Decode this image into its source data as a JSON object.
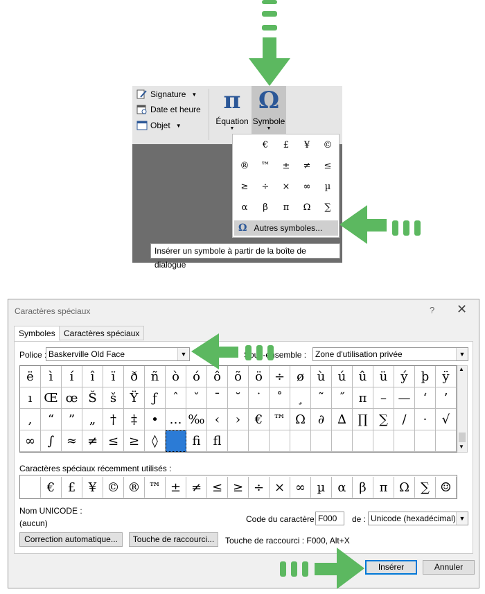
{
  "ribbon": {
    "signature": "Signature",
    "date_heure": "Date et heure",
    "objet": "Objet",
    "equation": "Équation",
    "symbole": "Symbole",
    "equation_glyph": "π",
    "symbole_glyph": "Ω"
  },
  "dropdown": {
    "symbols": [
      "",
      "€",
      "£",
      "¥",
      "©",
      "®",
      "™",
      "±",
      "≠",
      "≤",
      "≥",
      "÷",
      "×",
      "∞",
      "µ",
      "α",
      "β",
      "π",
      "Ω",
      "∑"
    ],
    "more_label": "Autres symboles...",
    "more_icon": "Ω"
  },
  "tooltip": "Insérer un symbole à partir de la boîte de dialogue",
  "stray_symbol": "",
  "dialog": {
    "title": "Caractères spéciaux",
    "help": "?",
    "close": "✕",
    "tabs": [
      "Symboles",
      "Caractères spéciaux"
    ],
    "police_label": "Police :",
    "police_value": "Baskerville Old Face",
    "sous_ensemble_label": "Sous-ensemble :",
    "sous_ensemble_value": "Zone d'utilisation privée",
    "grid": [
      [
        "ë",
        "ì",
        "í",
        "î",
        "ï",
        "ð",
        "ñ",
        "ò",
        "ó",
        "ô",
        "õ",
        "ö",
        "÷",
        "ø",
        "ù",
        "ú",
        "û",
        "ü",
        "ý",
        "þ",
        "ÿ"
      ],
      [
        "ı",
        "Œ",
        "œ",
        "Š",
        "š",
        "Ÿ",
        "ƒ",
        "ˆ",
        "ˇ",
        "¯",
        "˘",
        "˙",
        "˚",
        "¸",
        "˜",
        "˝",
        "π",
        "–",
        "—",
        "‘",
        "’"
      ],
      [
        ",",
        "“",
        "”",
        "„",
        "†",
        "‡",
        "•",
        "…",
        "‰",
        "‹",
        "›",
        "€",
        "™",
        "Ω",
        "∂",
        "∆",
        "∏",
        "∑",
        "∕",
        "·",
        "√"
      ],
      [
        "∞",
        "∫",
        "≈",
        "≠",
        "≤",
        "≥",
        "◊",
        "",
        "ﬁ",
        "ﬂ",
        "",
        "",
        "",
        "",
        "",
        "",
        "",
        "",
        "",
        "",
        ""
      ]
    ],
    "selected": {
      "row": 3,
      "col": 7
    },
    "recent_label": "Caractères spéciaux récemment utilisés :",
    "recent": [
      "",
      "€",
      "£",
      "¥",
      "©",
      "®",
      "™",
      "±",
      "≠",
      "≤",
      "≥",
      "÷",
      "×",
      "∞",
      "µ",
      "α",
      "β",
      "π",
      "Ω",
      "∑",
      "☺"
    ],
    "unicode_name_label": "Nom UNICODE :",
    "unicode_name_value": "(aucun)",
    "code_label": "Code du caractère :",
    "code_value": "F000",
    "de_label": "de :",
    "de_value": "Unicode (hexadécimal)",
    "autocorrect_btn": "Correction automatique...",
    "shortcut_btn": "Touche de raccourci...",
    "shortcut_info": "Touche de raccourci : F000, Alt+X",
    "insert_btn": "Insérer",
    "cancel_btn": "Annuler"
  },
  "colors": {
    "accent_green": "#5cb860",
    "selection_blue": "#2b7bd6",
    "icon_blue": "#2b5797"
  }
}
